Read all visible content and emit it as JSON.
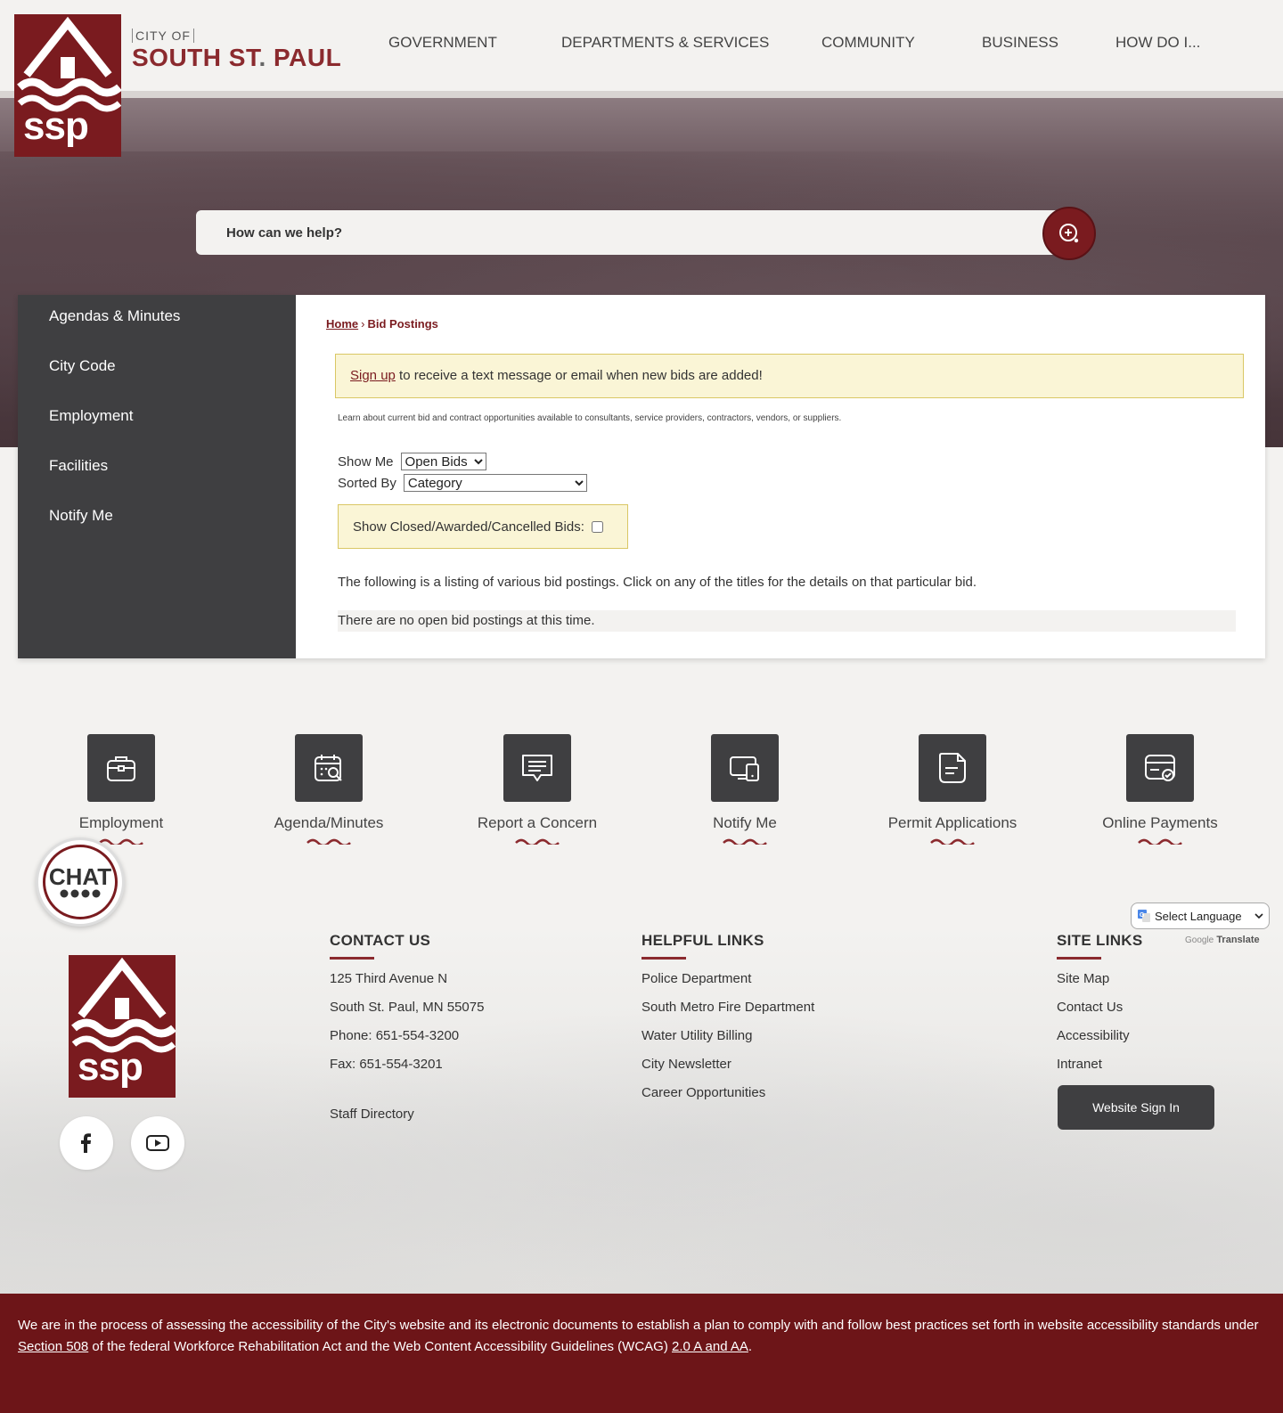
{
  "header": {
    "city_of": "CITY OF",
    "name_part1": "SOUTH ST",
    "name_dot": ".",
    "name_part2": " PAUL",
    "logo_text": "ssp",
    "nav": [
      "GOVERNMENT",
      "DEPARTMENTS & SERVICES",
      "COMMUNITY",
      "BUSINESS",
      "HOW DO I..."
    ]
  },
  "search": {
    "placeholder": "How can we help?"
  },
  "sidebar": {
    "items": [
      "Agendas & Minutes",
      "City Code",
      "Employment",
      "Facilities",
      "Notify Me"
    ]
  },
  "content": {
    "breadcrumb_home": "Home",
    "breadcrumb_sep": "›",
    "breadcrumb_current": "Bid Postings",
    "alert_link": "Sign up",
    "alert_text": " to receive a text message or email when new bids are added!",
    "intro": "Learn about current bid and contract opportunities available to consultants, service providers, contractors, vendors, or suppliers.",
    "show_me_label": "Show Me",
    "show_me_value": "Open Bids",
    "sorted_by_label": "Sorted By",
    "sorted_by_value": "Category",
    "closed_label": "Show Closed/Awarded/Cancelled Bids:",
    "listing_text": "The following is a listing of various bid postings. Click on any of the titles for the details on that particular bid.",
    "no_postings": "There are no open bid postings at this time."
  },
  "quick_links": [
    {
      "label": "Employment",
      "icon": "briefcase-icon"
    },
    {
      "label": "Agenda/Minutes",
      "icon": "calendar-search-icon"
    },
    {
      "label": "Report a Concern",
      "icon": "message-icon"
    },
    {
      "label": "Notify Me",
      "icon": "devices-icon"
    },
    {
      "label": "Permit Applications",
      "icon": "document-icon"
    },
    {
      "label": "Online Payments",
      "icon": "payment-card-icon"
    }
  ],
  "chat": {
    "label": "CHAT"
  },
  "footer": {
    "contact": {
      "title": "CONTACT US",
      "address1": "125 Third Avenue N",
      "address2": "South St. Paul, MN 55075",
      "phone": "Phone: 651-554-3200",
      "fax": "Fax: 651-554-3201",
      "staff": "Staff Directory"
    },
    "helpful": {
      "title": "HELPFUL LINKS",
      "items": [
        "Police Department",
        "South Metro Fire Department",
        "Water Utility Billing",
        "City Newsletter",
        "Career Opportunities"
      ]
    },
    "site": {
      "title": "SITE LINKS",
      "items": [
        "Site Map",
        "Contact Us",
        "Accessibility",
        "Intranet"
      ],
      "signin": "Website Sign In"
    },
    "translate": {
      "select": "Select Language",
      "powered_google": "Google",
      "powered_translate": "Translate"
    }
  },
  "accessibility": {
    "text1": "We are in the process of assessing the accessibility of the City's website and its electronic documents to establish a plan to comply with and follow best practices set forth in website accessibility standards under ",
    "link1": "Section 508",
    "text2": " of the federal Workforce Rehabilitation Act and the Web Content Accessibility Guidelines (WCAG) ",
    "link2": "2.0 A and AA",
    "text3": "."
  },
  "colors": {
    "brand": "#7a1b1f",
    "dark": "#3f3f41",
    "alert_bg": "#faf5d6",
    "footer_bar": "#6d1518"
  }
}
